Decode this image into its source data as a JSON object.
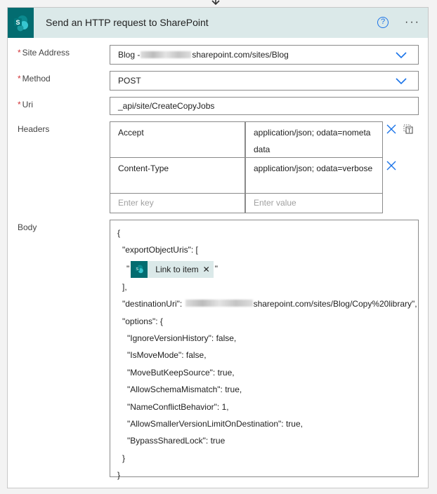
{
  "header": {
    "title": "Send an HTTP request to SharePoint",
    "help": "?",
    "more": "···"
  },
  "fields": {
    "site_address": {
      "label": "Site Address",
      "value_prefix": "Blog - ",
      "value_suffix": "sharepoint.com/sites/Blog"
    },
    "method": {
      "label": "Method",
      "value": "POST"
    },
    "uri": {
      "label": "Uri",
      "value": "_api/site/CreateCopyJobs"
    },
    "headers": {
      "label": "Headers",
      "rows": [
        {
          "key": "Accept",
          "value": "application/json; odata=nometadata"
        },
        {
          "key": "Content-Type",
          "value": "application/json; odata=verbose"
        }
      ],
      "key_placeholder": "Enter key",
      "value_placeholder": "Enter value"
    },
    "body": {
      "label": "Body",
      "lines": [
        "{",
        "\"exportObjectUris\": ["
      ],
      "token_open": "\"",
      "token_label": "Link to item",
      "token_close": "\"",
      "close_array": "],",
      "dest_prefix": "\"destinationUri\": ",
      "dest_suffix": "sharepoint.com/sites/Blog/Copy%20library\",",
      "options": [
        "\"options\": {",
        "\"IgnoreVersionHistory\": false,",
        "\"IsMoveMode\": false,",
        "\"MoveButKeepSource\": true,",
        "\"AllowSchemaMismatch\": true,",
        "\"NameConflictBehavior\": 1,",
        "\"AllowSmallerVersionLimitOnDestination\": true,",
        "\"BypassSharedLock\": true",
        "}",
        "}"
      ]
    }
  },
  "required_mark": "*",
  "colors": {
    "accent": "#1a73e8",
    "brand": "#036c70",
    "header_bg": "#dbe9e9",
    "required": "#d13438"
  }
}
